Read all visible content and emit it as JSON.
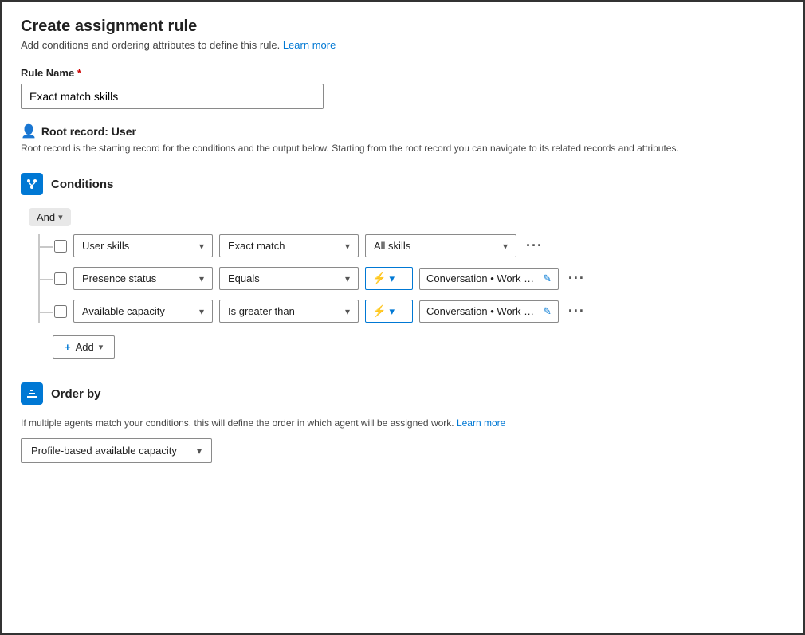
{
  "page": {
    "title": "Create assignment rule",
    "subtitle": "Add conditions and ordering attributes to define this rule.",
    "learn_more_label": "Learn more",
    "rule_name_label": "Rule Name",
    "rule_name_required": "*",
    "rule_name_value": "Exact match skills",
    "root_record_label": "Root record: User",
    "root_record_desc": "Root record is the starting record for the conditions and the output below. Starting from the root record you can navigate to its related records and attributes.",
    "conditions_label": "Conditions",
    "and_operator": "And",
    "conditions": [
      {
        "field": "User skills",
        "operator": "Exact match",
        "value_type": "text",
        "value": "All skills"
      },
      {
        "field": "Presence status",
        "operator": "Equals",
        "value_type": "lightning",
        "value": "Conversation • Work Stream • All..."
      },
      {
        "field": "Available capacity",
        "operator": "Is greater than",
        "value_type": "lightning",
        "value": "Conversation • Work Stream • Ca..."
      }
    ],
    "add_label": "Add",
    "order_by_label": "Order by",
    "order_by_desc": "If multiple agents match your conditions, this will define the order in which agent will be assigned work.",
    "order_by_learn_more": "Learn more",
    "order_by_value": "Profile-based available capacity"
  }
}
